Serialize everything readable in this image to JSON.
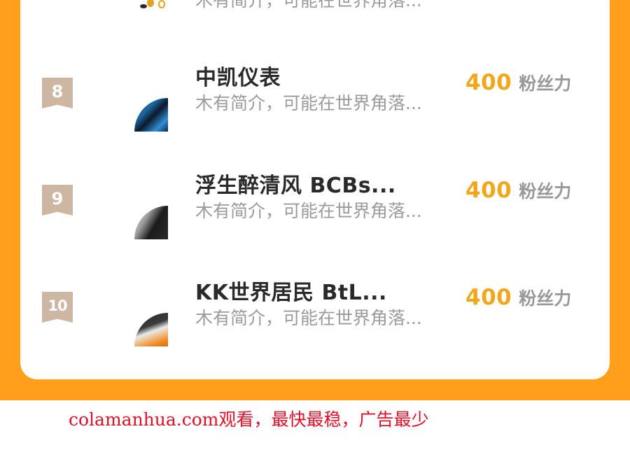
{
  "leaderboard": {
    "partial_row": {
      "desc": "木有简介，可能在世界角落..."
    },
    "rows": [
      {
        "rank": "8",
        "name": "中凯仪表",
        "desc": "木有简介，可能在世界角落...",
        "score": "400",
        "unit": "粉丝力"
      },
      {
        "rank": "9",
        "name": "浮生醉清风  BCBs...",
        "desc": "木有简介，可能在世界角落...",
        "score": "400",
        "unit": "粉丝力"
      },
      {
        "rank": "10",
        "name": "KK世界居民  BtL...",
        "desc": "木有简介，可能在世界角落...",
        "score": "400",
        "unit": "粉丝力"
      }
    ]
  },
  "footer": {
    "watermark": "colamanhua.com观看，最快最稳，广告最少"
  },
  "colors": {
    "panel": "#ff9f1c",
    "score": "#f0a71c",
    "badge": "#cdb7a3",
    "watermark": "#e0102a"
  }
}
